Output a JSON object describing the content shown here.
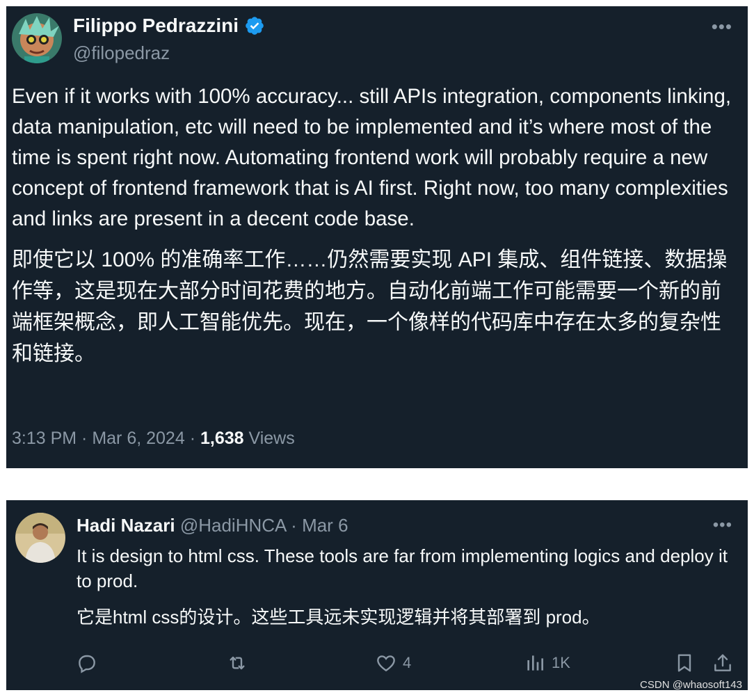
{
  "tweet": {
    "author_name": "Filippo Pedrazzini",
    "handle": "@filopedraz",
    "more_icon": "more-icon",
    "body_en": "Even if it works with 100% accuracy... still APIs integration, components linking, data manipulation, etc will need to be implemented and it’s where most of the time is spent right now. Automating frontend work will probably require a new concept of frontend framework that is AI first. Right now, too many complexities and links are present in a decent code base.",
    "body_zh": "即使它以 100% 的准确率工作……仍然需要实现 API 集成、组件链接、数据操作等，这是现在大部分时间花费的地方。自动化前端工作可能需要一个新的前端框架概念，即人工智能优先。现在，一个像样的代码库中存在太多的复杂性和链接。",
    "time": "3:13 PM",
    "date": "Mar 6, 2024",
    "views_count": "1,638",
    "views_label": "Views",
    "separator": " · "
  },
  "reply": {
    "author_name": "Hadi Nazari",
    "handle": "@HadiHNCA",
    "date": "Mar 6",
    "separator": " · ",
    "body_en": "It is design to html css. These tools are far from implementing logics and deploy it to prod.",
    "body_zh": "它是html css的设计。这些工具远未实现逻辑并将其部署到 prod。",
    "actions": {
      "reply_count": "",
      "retweet_count": "",
      "like_count": "4",
      "views_count": "1K"
    }
  },
  "watermark": "CSDN @whaosoft143",
  "colors": {
    "background": "#15202b",
    "text_primary": "#f7f9f9",
    "text_secondary": "#8b98a5",
    "verified": "#1d9bf0"
  }
}
